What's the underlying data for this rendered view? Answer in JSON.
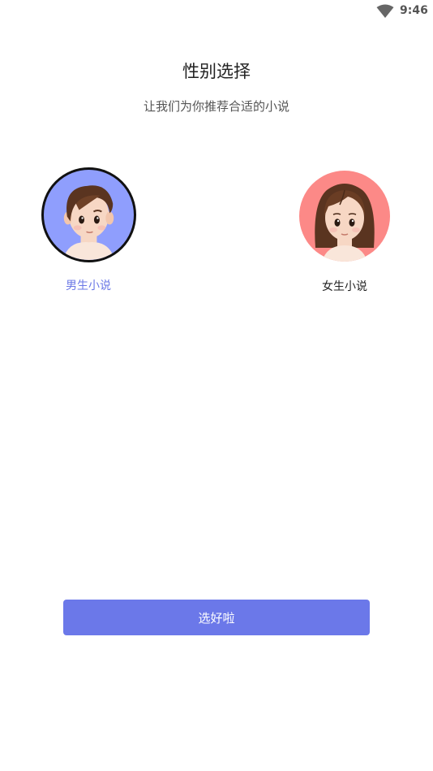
{
  "status_bar": {
    "time": "9:46",
    "icon": "wifi-icon"
  },
  "header": {
    "title": "性别选择",
    "subtitle": "让我们为你推荐合适的小说"
  },
  "options": [
    {
      "label": "男生小说",
      "icon": "boy-avatar-icon",
      "color": "#8f9efd",
      "selected": true
    },
    {
      "label": "女生小说",
      "icon": "girl-avatar-icon",
      "color": "#fc8987",
      "selected": false
    }
  ],
  "confirm_button": {
    "label": "选好啦",
    "color": "#6b78e9"
  }
}
